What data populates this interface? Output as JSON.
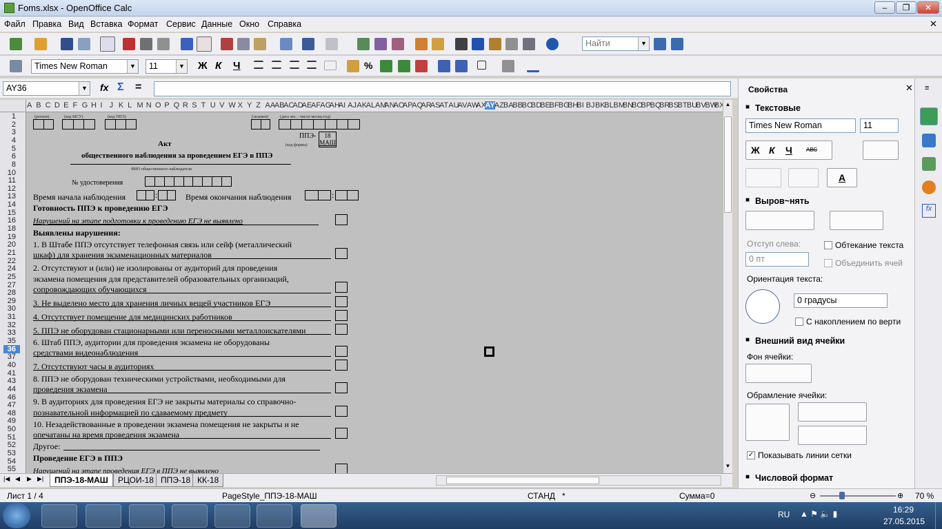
{
  "window": {
    "title": "Foms.xlsx - OpenOffice Calc"
  },
  "menu": [
    "Файл",
    "Правка",
    "Вид",
    "Вставка",
    "Формат",
    "Сервис",
    "Данные",
    "Окно",
    "Справка"
  ],
  "toolbar": {
    "find_placeholder": "Найти",
    "font_name": "Times New Roman",
    "font_size": "11",
    "bold": "Ж",
    "italic": "К",
    "underline": "Ч",
    "pct": "%"
  },
  "formula": {
    "cell_ref": "AY36",
    "fx": "fx",
    "sum": "Σ",
    "eq": "="
  },
  "columns": [
    "A",
    "B",
    "C",
    "D",
    "E",
    "F",
    "G",
    "H",
    "I",
    "J",
    "K",
    "L",
    "M",
    "N",
    "O",
    "P",
    "Q",
    "R",
    "S",
    "T",
    "U",
    "V",
    "W",
    "X",
    "Y",
    "Z",
    "AA",
    "AB",
    "AC",
    "AD",
    "AE",
    "AF",
    "AG",
    "AH",
    "AI",
    "AJ",
    "AK",
    "AL",
    "AM",
    "AN",
    "AO",
    "AP",
    "AQ",
    "AR",
    "AS",
    "AT",
    "AU",
    "AV",
    "AW",
    "AX",
    "AY",
    "AZ",
    "BA",
    "BB",
    "BC",
    "BD",
    "BE",
    "BF",
    "BG",
    "BH",
    "BI",
    "BJ",
    "BK",
    "BL",
    "BM",
    "BN",
    "BO",
    "BP",
    "BQ",
    "BR",
    "BS",
    "BT",
    "BU",
    "BV",
    "BW",
    "BX"
  ],
  "rows": [
    "1",
    "2",
    "3",
    "4",
    "5",
    "6",
    "8",
    "10",
    "11",
    "12",
    "13",
    "14",
    "15",
    "16",
    "18",
    "19",
    "20",
    "21",
    "22",
    "24",
    "25",
    "27",
    "28",
    "29",
    "30",
    "31",
    "32",
    "33",
    "35",
    "36",
    "37",
    "40",
    "41",
    "43",
    "44",
    "46",
    "47",
    "48",
    "49",
    "50",
    "51",
    "52",
    "53",
    "54",
    "55"
  ],
  "sheet": {
    "cap_region": "(регион)",
    "cap_msu": "(код МСУ)",
    "cap_ppe": "(код ППЭ)",
    "cap_exam": "(экзамен)",
    "cap_date": "(дата экз. - число-месяц-год)",
    "ppe_label": "ППЭ-",
    "form_num": "18",
    "form_suffix": "МАШ",
    "cap_form_code": "(код формы)",
    "doc_title": "Акт",
    "doc_subtitle": "общественного наблюдения за проведением ЕГЭ в ППЭ",
    "cap_fio": "ФИО общественного наблюдателя",
    "id_label": "№  удостоверения",
    "start_label": "Время начала наблюдения",
    "end_label": "Время окончания наблюдения",
    "colon": ":",
    "readiness": "Готовность ППЭ к проведению ЕГЭ",
    "no_violations_prep": "Нарушений на этапе подготовки к проведению ЕГЭ не выявлено",
    "found": "Выявлены нарушения:",
    "items": [
      "1. В Штабе ППЭ отсутствует телефонная связь или сейф (металлический",
      "шкаф) для хранения экзаменационных материалов",
      "2. Отсутствуют и (или) не изолированы от аудиторий для проведения",
      "экзамена помещения для представителей образовательных организаций,",
      "сопровождающих обучающихся",
      "3. Не выделено место для хранения личных вещей участников ЕГЭ",
      "4. Отсутствует помещение для медицинских работников",
      "5. ППЭ не оборудован стационарными или переносными металлоискателями",
      "6. Штаб ППЭ, аудитории для проведения экзамена не оборудованы",
      "средствами видеонаблюдения",
      "7. Отсутствуют часы в аудиториях",
      "8. ППЭ не оборудован техническими устройствами, необходимыми для",
      "проведения экзамена",
      "9. В аудиториях для проведения ЕГЭ не закрыты материалы со справочно-",
      "познавательной информацией по сдаваемому предмету",
      "10. Незадействованные в проведении экзамена помещения не закрыты и не",
      "опечатаны на время проведения экзамена"
    ],
    "other": "Другое:",
    "conduct": "Проведение ЕГЭ в ППЭ",
    "no_violations_conduct": "Нарушений на этапе проведения ЕГЭ в ППЭ не выявлено"
  },
  "tabs": [
    "ППЭ-18-МАШ",
    "РЦОИ-18",
    "ППЭ-18",
    "КК-18"
  ],
  "status": {
    "sheet": "Лист 1 / 4",
    "page_style": "PageStyle_ППЭ-18-МАШ",
    "mode": "СТАНД",
    "modified": "*",
    "sum": "Сумма=0",
    "zoom": "70 %"
  },
  "sidebar": {
    "title": "Свойства",
    "text_section": "Текстовые",
    "font": "Times New Roman",
    "size": "11",
    "align_section": "Выров~нять",
    "indent_label": "Отступ слева:",
    "indent_value": "0 пт",
    "wrap": "Обтекание текста",
    "merge": "Объединить ячей",
    "orient_label": "Ориентация текста:",
    "orient_value": "0 градусы",
    "stacked": "С накоплением по верти",
    "appearance_section": "Внешний вид ячейки",
    "bg_label": "Фон ячейки:",
    "border_label": "Обрамление ячейки:",
    "gridlines": "Показывать линии сетки",
    "number_section": "Числовой формат",
    "b": "Ж",
    "i": "К",
    "u": "Ч",
    "abc": "АВС",
    "fontcolor": "A"
  },
  "taskbar": {
    "lang": "RU",
    "time": "16:29",
    "date": "27.05.2015"
  },
  "colors": {
    "titlebar": "#c2d5ec",
    "taskbar": "#1e3d63",
    "sheet_bg": "#c0c0c0",
    "active_col": "#4a86d4"
  }
}
